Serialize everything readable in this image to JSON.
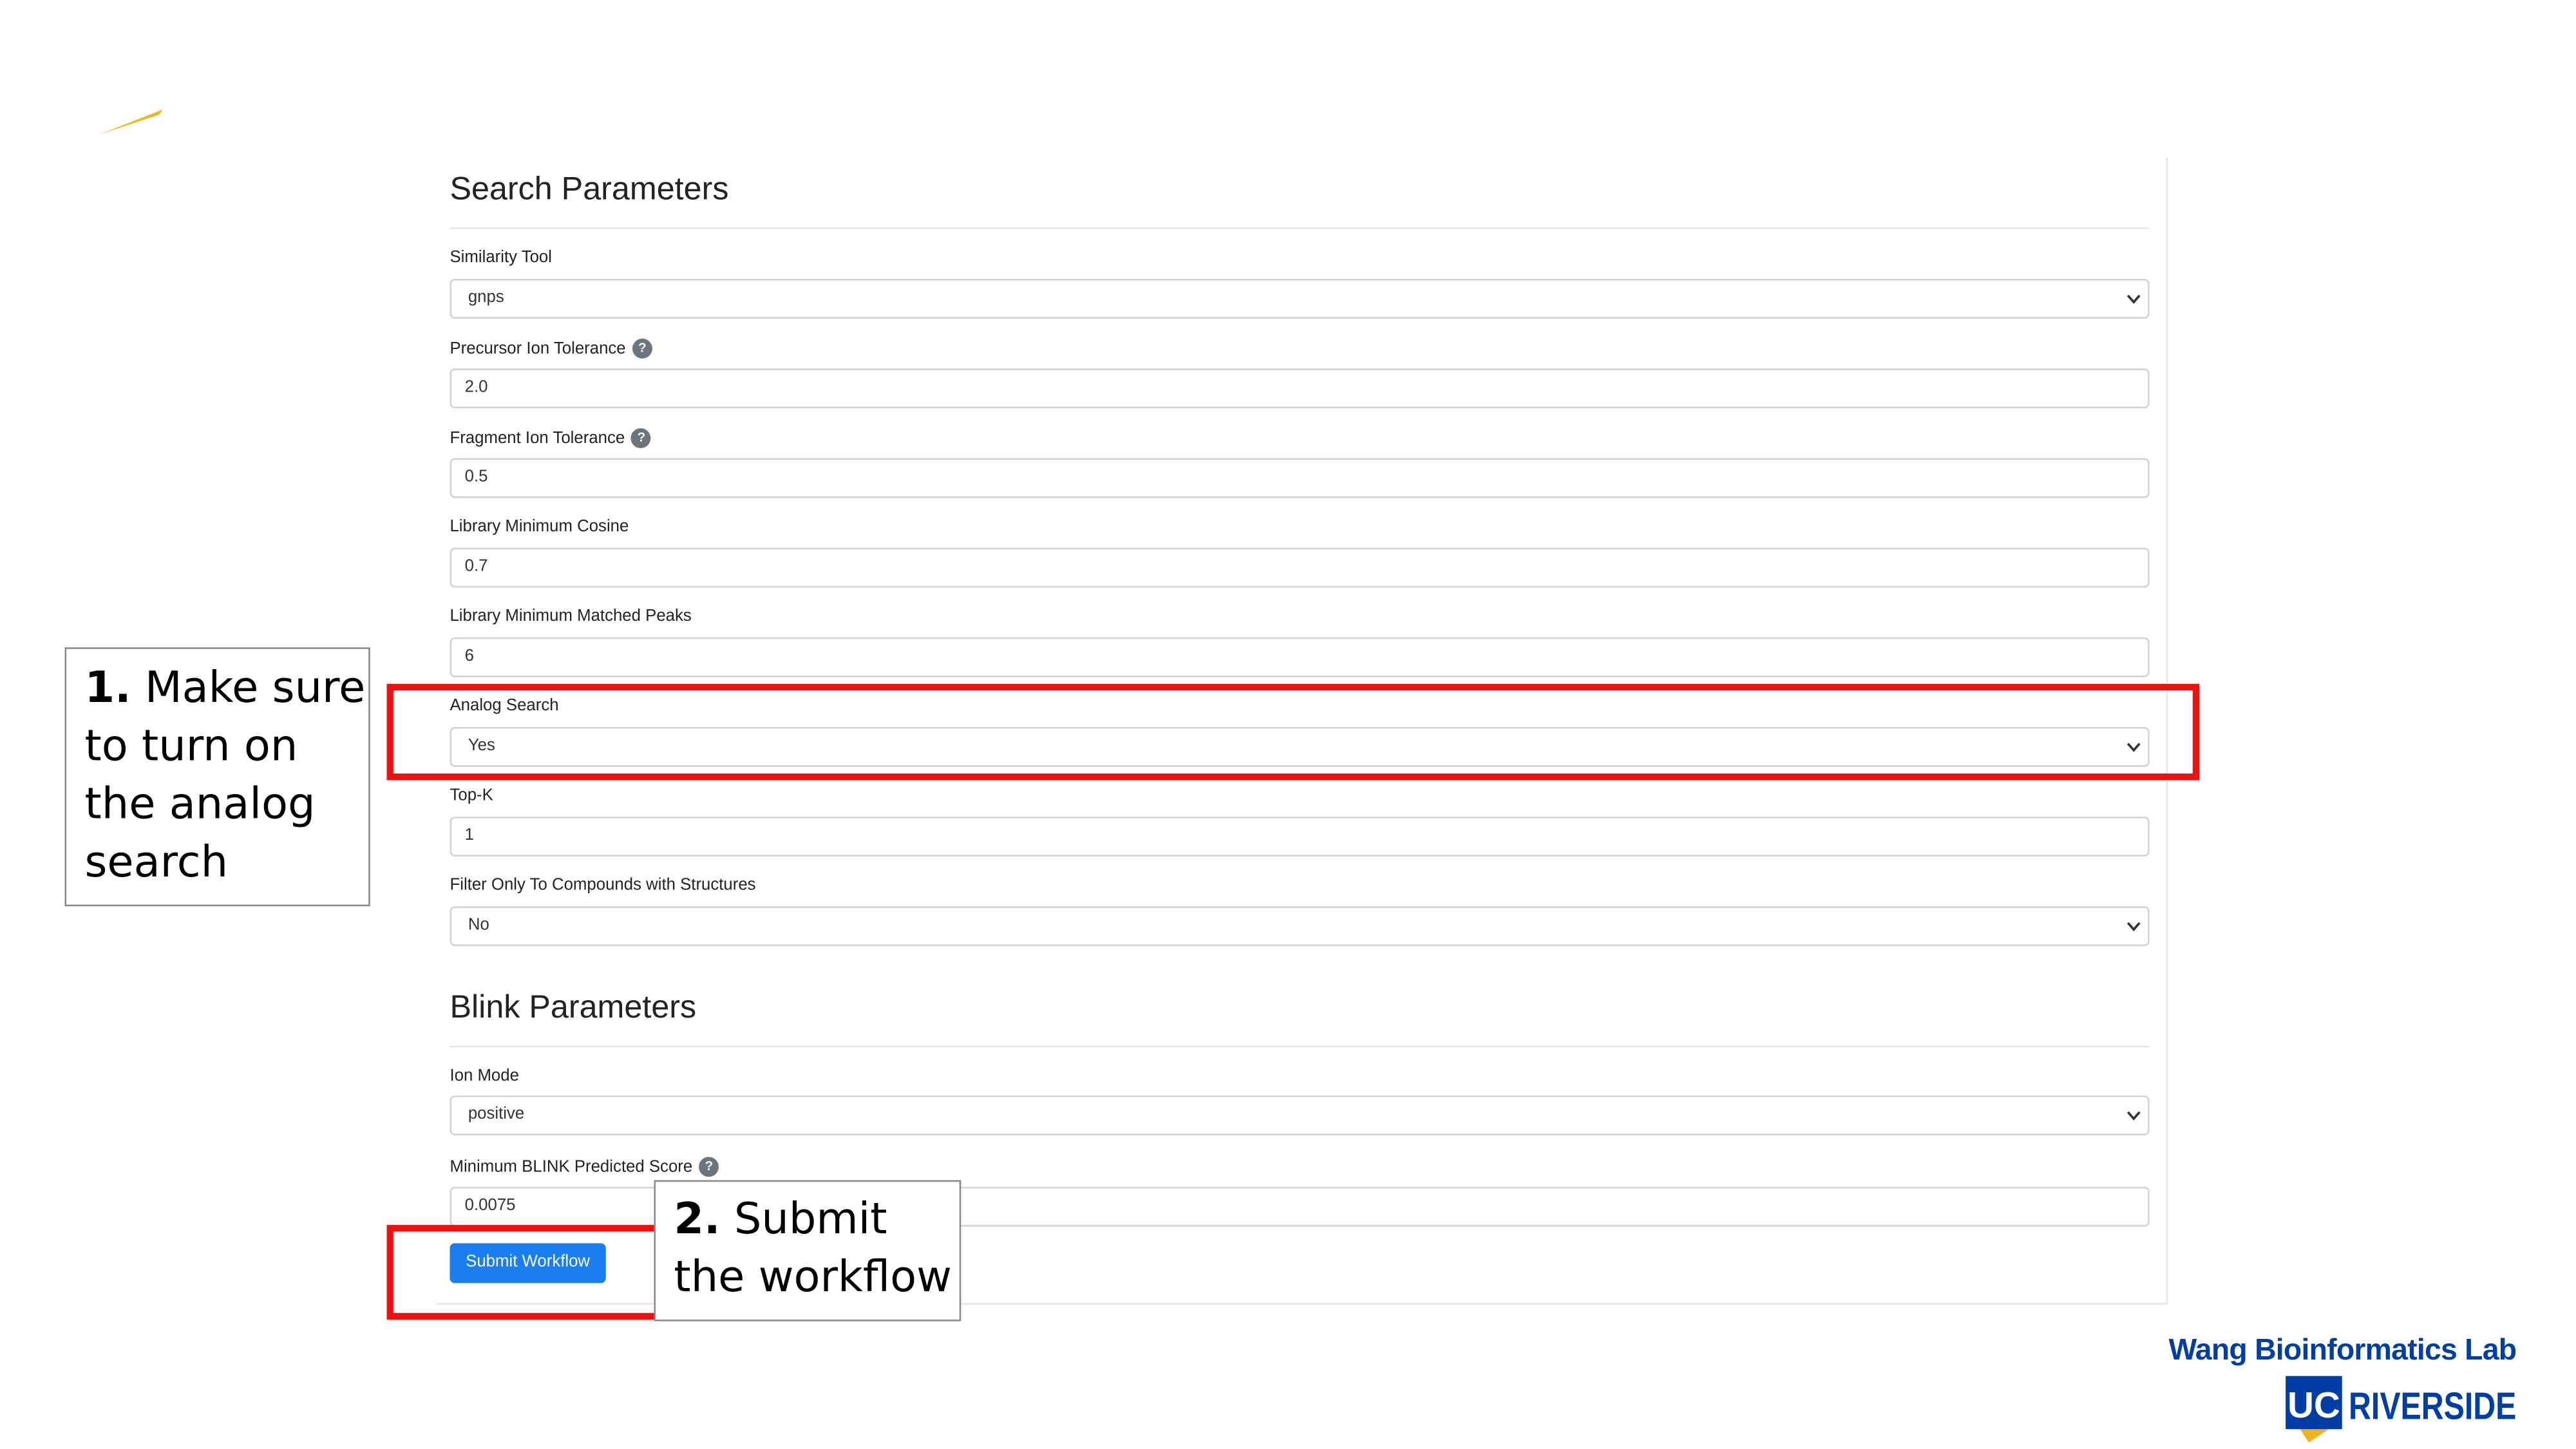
{
  "search_section": {
    "title": "Search Parameters",
    "similarity_tool": {
      "label": "Similarity Tool",
      "value": "gnps"
    },
    "precursor_tolerance": {
      "label": "Precursor Ion Tolerance",
      "value": "2.0"
    },
    "fragment_tolerance": {
      "label": "Fragment Ion Tolerance",
      "value": "0.5"
    },
    "min_cosine": {
      "label": "Library Minimum Cosine",
      "value": "0.7"
    },
    "min_peaks": {
      "label": "Library Minimum Matched Peaks",
      "value": "6"
    },
    "analog_search": {
      "label": "Analog Search",
      "value": "Yes"
    },
    "top_k": {
      "label": "Top-K",
      "value": "1"
    },
    "filter_structures": {
      "label": "Filter Only To Compounds with Structures",
      "value": "No"
    }
  },
  "blink_section": {
    "title": "Blink Parameters",
    "ion_mode": {
      "label": "Ion Mode",
      "value": "positive"
    },
    "min_score": {
      "label": "Minimum BLINK Predicted Score",
      "value": "0.0075"
    }
  },
  "submit": {
    "label": "Submit Workflow"
  },
  "callouts": {
    "first": {
      "number": "1.",
      "lines": [
        "Make sure",
        "to turn on",
        "the analog",
        "search"
      ]
    },
    "second": {
      "number": "2.",
      "lines": [
        "Submit",
        "the workflow"
      ]
    }
  },
  "branding": {
    "lab": "Wang Bioinformatics Lab",
    "uc": "UC",
    "campus": "RIVERSIDE"
  },
  "help_glyph": "?",
  "colors": {
    "accent": "#1a7ef0",
    "highlight": "#ee1111",
    "brand_blue": "#003da5",
    "brand_gold": "#f2b21c"
  }
}
